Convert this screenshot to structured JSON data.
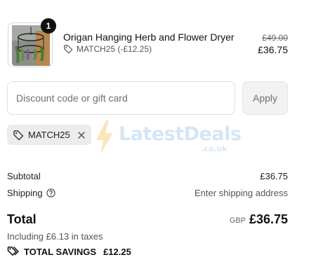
{
  "product": {
    "quantity": "1",
    "name": "Origan Hanging Herb and Flower Dryer",
    "discount_note": "MATCH25 (-£12.25)",
    "original_price": "£49.00",
    "price": "£36.75",
    "icons": {
      "thumbnail": "herb-dryer-image",
      "discount": "tag-icon"
    }
  },
  "discount": {
    "placeholder": "Discount code or gift card",
    "value": "",
    "apply_label": "Apply",
    "applied_code": "MATCH25",
    "icons": {
      "code": "tag-icon",
      "remove": "close-icon"
    }
  },
  "watermark": {
    "brand": "LatestDeals",
    "suffix": ".co.uk",
    "icon": "lightning-bolt-icon"
  },
  "summary": {
    "subtotal_label": "Subtotal",
    "subtotal_value": "£36.75",
    "shipping_label": "Shipping",
    "shipping_value": "Enter shipping address",
    "shipping_help_icon": "question-circle-icon",
    "total_label": "Total",
    "currency": "GBP",
    "total_value": "£36.75",
    "taxes_note": "Including £6.13 in taxes",
    "savings_label": "TOTAL SAVINGS",
    "savings_value": "£12.25",
    "savings_icon": "tags-icon"
  }
}
